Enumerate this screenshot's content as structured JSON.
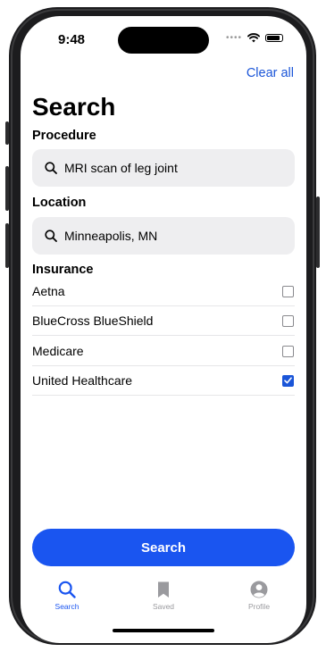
{
  "status": {
    "time": "9:48"
  },
  "header": {
    "clear_all": "Clear all",
    "title": "Search"
  },
  "procedure": {
    "label": "Procedure",
    "value": "MRI scan of leg joint"
  },
  "location": {
    "label": "Location",
    "value": "Minneapolis, MN"
  },
  "insurance": {
    "label": "Insurance",
    "options": [
      {
        "label": "Aetna",
        "checked": false
      },
      {
        "label": "BlueCross BlueShield",
        "checked": false
      },
      {
        "label": "Medicare",
        "checked": false
      },
      {
        "label": "United Healthcare",
        "checked": true
      }
    ]
  },
  "search_button": "Search",
  "tabbar": {
    "tabs": [
      {
        "label": "Search",
        "icon": "search-icon",
        "active": true
      },
      {
        "label": "Saved",
        "icon": "bookmark-icon",
        "active": false
      },
      {
        "label": "Profile",
        "icon": "profile-icon",
        "active": false
      }
    ]
  },
  "colors": {
    "accent": "#1a55f0",
    "link": "#1a55d8",
    "inactive_tab": "#9a9a9e"
  }
}
